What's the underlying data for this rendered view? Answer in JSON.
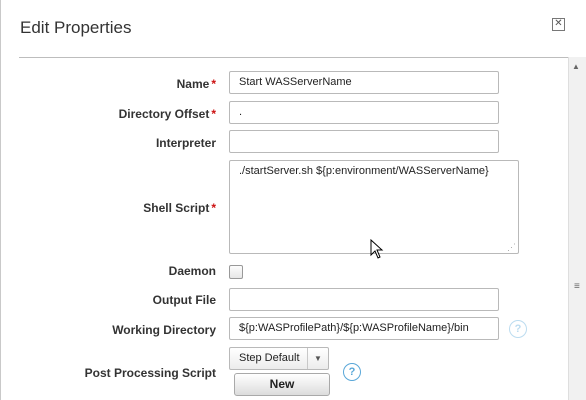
{
  "dialog": {
    "title": "Edit Properties",
    "close_icon": "close-icon"
  },
  "form": {
    "name": {
      "label": "Name",
      "value": "Start WASServerName",
      "required": true
    },
    "directory_offset": {
      "label": "Directory Offset",
      "value": ".",
      "required": true
    },
    "interpreter": {
      "label": "Interpreter",
      "value": ""
    },
    "shell_script": {
      "label": "Shell Script",
      "value": "./startServer.sh ${p:environment/WASServerName}",
      "required": true
    },
    "daemon": {
      "label": "Daemon",
      "checked": false
    },
    "output_file": {
      "label": "Output File",
      "value": ""
    },
    "working_directory": {
      "label": "Working Directory",
      "value": "${p:WASProfilePath}/${p:WASProfileName}/bin"
    },
    "post_processing_script": {
      "label": "Post Processing Script",
      "selected": "Step Default",
      "new_button": "New"
    }
  },
  "required_mark": "*",
  "help_glyph": "?",
  "colors": {
    "required": "#cc1111",
    "help": "#59a7d8"
  }
}
